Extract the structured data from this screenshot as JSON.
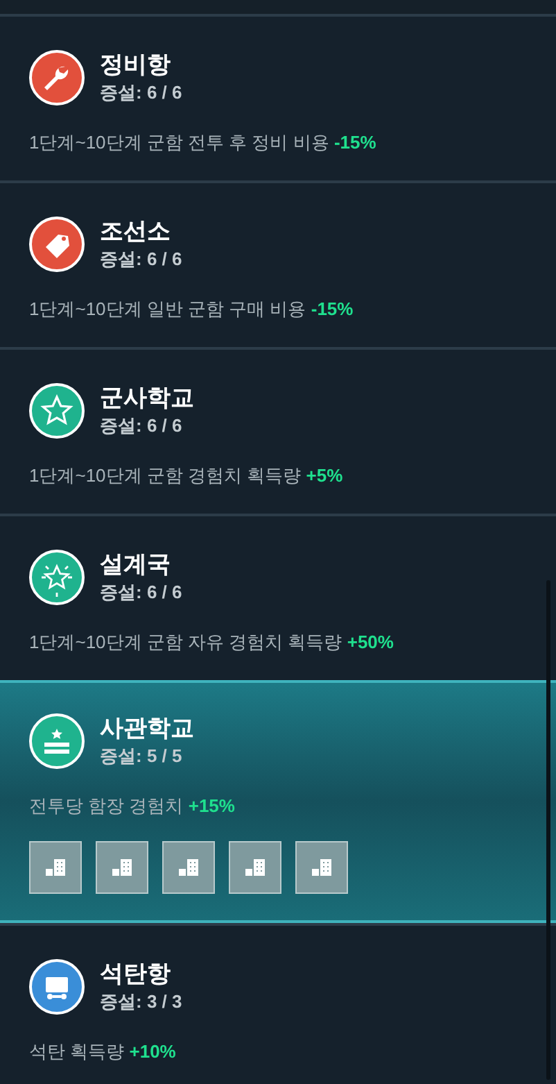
{
  "buildings": [
    {
      "kind": "wrench",
      "color": "#e2503c",
      "name": "정비항",
      "level_text": "증설: 6 / 6",
      "description": "1단계~10단계 군함 전투 후 정비 비용",
      "bonus": "-15%",
      "selected": false
    },
    {
      "kind": "tag",
      "color": "#e2503c",
      "name": "조선소",
      "level_text": "증설: 6 / 6",
      "description": "1단계~10단계 일반 군함 구매 비용",
      "bonus": "-15%",
      "selected": false
    },
    {
      "kind": "star",
      "color": "#1fb38e",
      "name": "군사학교",
      "level_text": "증설: 6 / 6",
      "description": "1단계~10단계 군함 경험치 획득량",
      "bonus": "+5%",
      "selected": false
    },
    {
      "kind": "burst",
      "color": "#1fb38e",
      "name": "설계국",
      "level_text": "증설: 6 / 6",
      "description": "1단계~10단계 군함 자유 경험치 획득량",
      "bonus": "+50%",
      "selected": false
    },
    {
      "kind": "academy",
      "color": "#1fb38e",
      "name": "사관학교",
      "level_text": "증설: 5 / 5",
      "description": "전투당 함장 경험치",
      "bonus": "+15%",
      "selected": true,
      "slots": [
        {
          "kind": "building"
        },
        {
          "kind": "building"
        },
        {
          "kind": "building"
        },
        {
          "kind": "building"
        },
        {
          "kind": "building"
        }
      ]
    },
    {
      "kind": "cart",
      "color": "#3a8ed8",
      "name": "석탄항",
      "level_text": "증설: 3 / 3",
      "description": "석탄 획득량",
      "bonus": "+10%",
      "selected": false
    }
  ]
}
